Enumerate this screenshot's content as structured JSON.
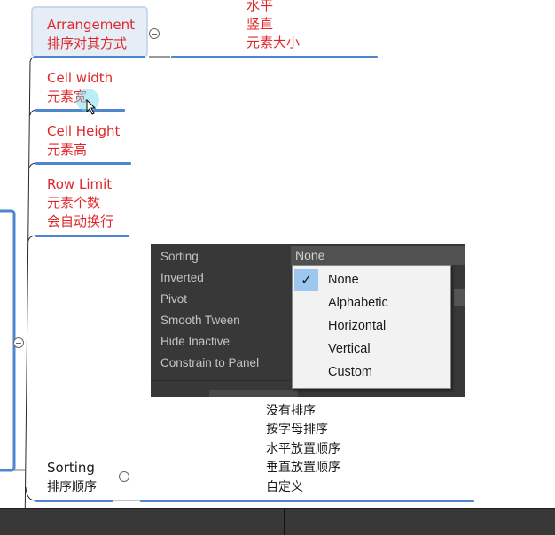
{
  "mindmap": {
    "arrangement": {
      "title": "Arrangement",
      "subtitle": "排序对其方式",
      "children": [
        "水平",
        "竖直",
        "元素大小"
      ]
    },
    "cell_width": {
      "title": "Cell width",
      "subtitle": "元素宽"
    },
    "cell_height": {
      "title": "Cell Height",
      "subtitle": "元素高"
    },
    "row_limit": {
      "title": "Row Limit",
      "subtitle": "元素个数",
      "note": "会自动换行"
    },
    "sorting": {
      "title": "Sorting",
      "subtitle": "排序顺序",
      "children": [
        "没有排序",
        "按字母排序",
        "水平放置顺序",
        "垂直放置顺序",
        "自定义"
      ]
    }
  },
  "inspector": {
    "labels": [
      "Sorting",
      "Inverted",
      "Pivot",
      "Smooth Tween",
      "Hide Inactive",
      "Constrain to Panel"
    ],
    "sorting_value": "None",
    "dropdown": {
      "options": [
        "None",
        "Alphabetic",
        "Horizontal",
        "Vertical",
        "Custom"
      ],
      "selected": "None",
      "check_icon": "✓"
    }
  },
  "colors": {
    "accent_line": "#4f86d0",
    "red_text": "#e0262a",
    "panel_bg": "#383838"
  }
}
